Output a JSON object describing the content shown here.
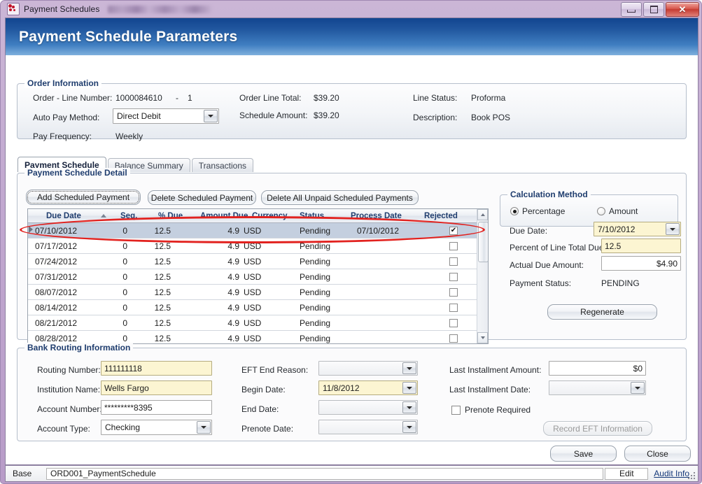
{
  "window": {
    "title": "Payment Schedules",
    "icon": "payment-schedules-icon",
    "redacted_title_suffix": "",
    "minimize_label": "",
    "maximize_label": "",
    "close_label": "✕"
  },
  "banner": {
    "title": "Payment Schedule Parameters"
  },
  "order_information": {
    "legend": "Order Information",
    "order_line_number_label": "Order - Line Number:",
    "order_number": "1000084610",
    "dash": "-",
    "line_number": "1",
    "auto_pay_method_label": "Auto Pay Method:",
    "auto_pay_method_value": "Direct Debit",
    "pay_frequency_label": "Pay Frequency:",
    "pay_frequency_value": "Weekly",
    "order_line_total_label": "Order Line Total:",
    "order_line_total_value": "$39.20",
    "schedule_amount_label": "Schedule Amount:",
    "schedule_amount_value": "$39.20",
    "line_status_label": "Line Status:",
    "line_status_value": "Proforma",
    "description_label": "Description:",
    "description_value": "Book POS"
  },
  "tabs": [
    {
      "label": "Payment Schedule",
      "active": true
    },
    {
      "label": "Balance Summary",
      "active": false
    },
    {
      "label": "Transactions",
      "active": false
    }
  ],
  "payment_schedule_detail": {
    "legend": "Payment Schedule Detail",
    "buttons": {
      "add": "Add Scheduled Payment",
      "delete": "Delete Scheduled Payment",
      "delete_all": "Delete All Unpaid Scheduled Payments"
    },
    "grid": {
      "columns": [
        "Due Date",
        "Seq.",
        "% Due",
        "Amount Due",
        "Currency",
        "Status",
        "Process Date",
        "Rejected"
      ],
      "sort_column": "Due Date",
      "sort_direction": "ascending",
      "rows": [
        {
          "due_date": "07/10/2012",
          "seq": "0",
          "pct_due": "12.5",
          "amount_due": "4.9",
          "currency": "USD",
          "status": "Pending",
          "process_date": "07/10/2012",
          "rejected": true,
          "selected": true
        },
        {
          "due_date": "07/17/2012",
          "seq": "0",
          "pct_due": "12.5",
          "amount_due": "4.9",
          "currency": "USD",
          "status": "Pending",
          "process_date": "",
          "rejected": false,
          "selected": false
        },
        {
          "due_date": "07/24/2012",
          "seq": "0",
          "pct_due": "12.5",
          "amount_due": "4.9",
          "currency": "USD",
          "status": "Pending",
          "process_date": "",
          "rejected": false,
          "selected": false
        },
        {
          "due_date": "07/31/2012",
          "seq": "0",
          "pct_due": "12.5",
          "amount_due": "4.9",
          "currency": "USD",
          "status": "Pending",
          "process_date": "",
          "rejected": false,
          "selected": false
        },
        {
          "due_date": "08/07/2012",
          "seq": "0",
          "pct_due": "12.5",
          "amount_due": "4.9",
          "currency": "USD",
          "status": "Pending",
          "process_date": "",
          "rejected": false,
          "selected": false
        },
        {
          "due_date": "08/14/2012",
          "seq": "0",
          "pct_due": "12.5",
          "amount_due": "4.9",
          "currency": "USD",
          "status": "Pending",
          "process_date": "",
          "rejected": false,
          "selected": false
        },
        {
          "due_date": "08/21/2012",
          "seq": "0",
          "pct_due": "12.5",
          "amount_due": "4.9",
          "currency": "USD",
          "status": "Pending",
          "process_date": "",
          "rejected": false,
          "selected": false
        },
        {
          "due_date": "08/28/2012",
          "seq": "0",
          "pct_due": "12.5",
          "amount_due": "4.9",
          "currency": "USD",
          "status": "Pending",
          "process_date": "",
          "rejected": false,
          "selected": false
        }
      ]
    }
  },
  "calculation_method": {
    "legend": "Calculation Method",
    "options": [
      {
        "label": "Percentage",
        "checked": true
      },
      {
        "label": "Amount",
        "checked": false
      }
    ],
    "due_date_label": "Due Date:",
    "due_date_value": "7/10/2012",
    "percent_label": "Percent of Line Total Due:",
    "percent_value": "12.5",
    "actual_due_label": "Actual Due Amount:",
    "actual_due_value": "$4.90",
    "payment_status_label": "Payment Status:",
    "payment_status_value": "PENDING",
    "regenerate_label": "Regenerate"
  },
  "bank_routing": {
    "legend": "Bank Routing Information",
    "routing_number_label": "Routing Number:",
    "routing_number_value": "111111118",
    "institution_name_label": "Institution Name:",
    "institution_name_value": "Wells Fargo",
    "account_number_label": "Account Number:",
    "account_number_value": "*********8395",
    "account_type_label": "Account Type:",
    "account_type_value": "Checking",
    "eft_end_reason_label": "EFT End Reason:",
    "eft_end_reason_value": "",
    "begin_date_label": "Begin Date:",
    "begin_date_value": "11/8/2012",
    "end_date_label": "End Date:",
    "end_date_value": "",
    "prenote_date_label": "Prenote Date:",
    "prenote_date_value": "",
    "last_installment_amount_label": "Last Installment Amount:",
    "last_installment_amount_value": "$0",
    "last_installment_date_label": "Last Installment Date:",
    "last_installment_date_value": "",
    "prenote_required_label": "Prenote Required",
    "prenote_required_checked": false,
    "record_eft_label": "Record EFT Information"
  },
  "footer": {
    "save_label": "Save",
    "close_label": "Close"
  },
  "statusbar": {
    "base_label": "Base",
    "base_value": "ORD001_PaymentSchedule",
    "edit_label": "Edit",
    "audit_label": "Audit Info"
  },
  "colors": {
    "banner_top": "#11458f",
    "banner_bottom": "#7fb0dd",
    "group_legend": "#1f3d6e",
    "grid_header_text": "#1f3d6e",
    "selection": "#c4cfdf",
    "annotation": "#e2221f",
    "required_field": "#fcf5d2",
    "titlebar": "#c2a9d0",
    "link": "#14387a"
  }
}
